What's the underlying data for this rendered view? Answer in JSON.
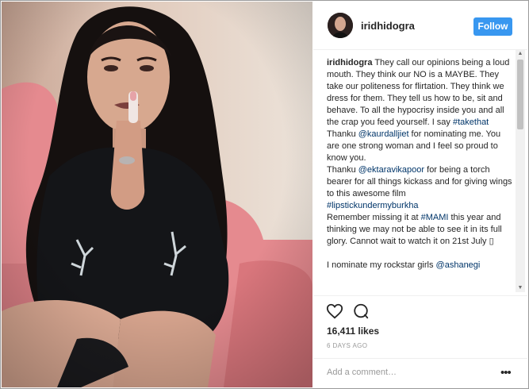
{
  "post": {
    "username": "iridhidogra",
    "follow_label": "Follow",
    "caption_lines": [
      "They call our opinions being a loud mouth. They think our NO is a MAYBE. They take our politeness for flirtation. They think we dress for them. They tell us how to be, sit and behave. To all the hypocrisy inside you and all the crap you feed yourself. I say "
    ],
    "hashtag_takethat": "#takethat",
    "thanku1_pre": "Thanku ",
    "mention_kaur": "@kaurdalljiet",
    "thanku1_post": " for nominating me. You are one strong woman and I feel so proud to know you.",
    "thanku2_pre": "Thanku ",
    "mention_ekta": "@ektaravikapoor",
    "thanku2_post": " for being a torch bearer for all things kickass and for giving wings to this awesome film",
    "hashtag_lipstick": "#lipstickundermyburkha",
    "remember_pre": "Remember missing it at ",
    "hashtag_mami": "#MAMI",
    "remember_post": " this year and thinking we may not be able to see it in its full glory. Cannot wait to watch it on 21st July ▯",
    "nominate_pre": "I nominate my rockstar girls ",
    "mention_ashanegi": "@ashanegi",
    "likes": "16,411 likes",
    "date": "6 DAYS AGO",
    "comment_placeholder": "Add a comment…",
    "more_glyph": "•••"
  },
  "colors": {
    "follow_bg": "#3897f0",
    "link": "#003569"
  },
  "icons": [
    "heart-icon",
    "comment-icon",
    "more-options-icon",
    "avatar"
  ]
}
